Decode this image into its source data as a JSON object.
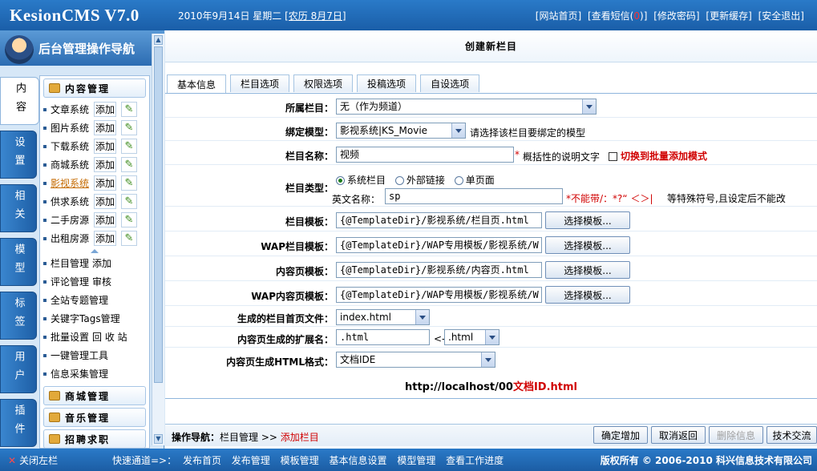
{
  "header": {
    "logo": "KesionCMS V7.0",
    "date": "2010年9月14日 星期二",
    "lunar": "[农历 8月7日]",
    "links": [
      "[网站首页]",
      "[查看短信(",
      "0",
      ")]",
      "[修改密码]",
      "[更新缓存]",
      "[安全退出]"
    ]
  },
  "sidebar": {
    "title": "后台管理操作导航",
    "vtabs": [
      "内容",
      "设置",
      "相关",
      "模型",
      "标签",
      "用户",
      "插件"
    ],
    "section1": "内容管理",
    "modules": [
      {
        "label": "文章系统",
        "add": "添加"
      },
      {
        "label": "图片系统",
        "add": "添加"
      },
      {
        "label": "下载系统",
        "add": "添加"
      },
      {
        "label": "商城系统",
        "add": "添加"
      },
      {
        "label": "影视系统",
        "add": "添加"
      },
      {
        "label": "供求系统",
        "add": "添加"
      },
      {
        "label": "二手房源",
        "add": "添加"
      },
      {
        "label": "出租房源",
        "add": "添加"
      }
    ],
    "links": [
      {
        "label": "栏目管理",
        "extra": "添加"
      },
      {
        "label": "评论管理",
        "extra": "审核"
      },
      {
        "label": "全站专题管理",
        "extra": ""
      },
      {
        "label": "关键字Tags管理",
        "extra": ""
      },
      {
        "label": "批量设置",
        "extra": "回 收 站"
      },
      {
        "label": "一键管理工具",
        "extra": ""
      },
      {
        "label": "信息采集管理",
        "extra": ""
      }
    ],
    "section2": "商城管理",
    "section3": "音乐管理",
    "section4": "招聘求职"
  },
  "main": {
    "title": "创建新栏目",
    "tabs": [
      "基本信息",
      "栏目选项",
      "权限选项",
      "投稿选项",
      "自设选项"
    ],
    "form": {
      "parent": {
        "label": "所属栏目：",
        "value": "无（作为频道）"
      },
      "model": {
        "label": "绑定模型：",
        "value": "影视系统|KS_Movie",
        "hint": "请选择该栏目要绑定的模型"
      },
      "name": {
        "label": "栏目名称：",
        "value": "视频",
        "star": "*",
        "hint": "概括性的说明文字",
        "batch": "切换到批量添加模式"
      },
      "type": {
        "label": "栏目类型：",
        "opt1": "系统栏目",
        "opt2": "外部链接",
        "opt3": "单页面",
        "en_label": "英文名称：",
        "en_value": "sp",
        "warn": "*不能带/：*?“ ＜＞|",
        "warn2": "等特殊符号,且设定后不能改"
      },
      "tpl": {
        "label": "栏目模板：",
        "value": "{@TemplateDir}/影视系统/栏目页.html",
        "btn": "选择模板..."
      },
      "waptpl": {
        "label": "WAP栏目模板：",
        "value": "{@TemplateDir}/WAP专用模板/影视系统/W",
        "btn": "选择模板..."
      },
      "ctpl": {
        "label": "内容页模板：",
        "value": "{@TemplateDir}/影视系统/内容页.html",
        "btn": "选择模板..."
      },
      "wapctpl": {
        "label": "WAP内容页模板：",
        "value": "{@TemplateDir}/WAP专用模板/影视系统/W",
        "btn": "选择模板..."
      },
      "index": {
        "label": "生成的栏目首页文件：",
        "value": "index.html"
      },
      "ext": {
        "label": "内容页生成的扩展名：",
        "value": ".html",
        "arrow": "<-",
        "select": ".html"
      },
      "fmt": {
        "label": "内容页生成HTML格式：",
        "value": "文档IDE"
      },
      "url_prefix": "http://localhost/00",
      "url_suffix": "文档ID.html"
    },
    "bottom": {
      "crumb_label": "操作导航：",
      "crumb_1": "栏目管理",
      "crumb_sep": ">>",
      "crumb_2": "添加栏目",
      "buttons": [
        "确定增加",
        "取消返回",
        "删除信息",
        "技术交流"
      ]
    }
  },
  "statusbar": {
    "close_x": "✕",
    "close_left": "关闭左栏",
    "quick_label": "快速通道=>：",
    "quick": [
      "发布首页",
      "发布管理",
      "模板管理",
      "基本信息设置",
      "模型管理",
      "查看工作进度"
    ],
    "copyright": "版权所有 © 2006-2010 科兴信息技术有限公司"
  }
}
